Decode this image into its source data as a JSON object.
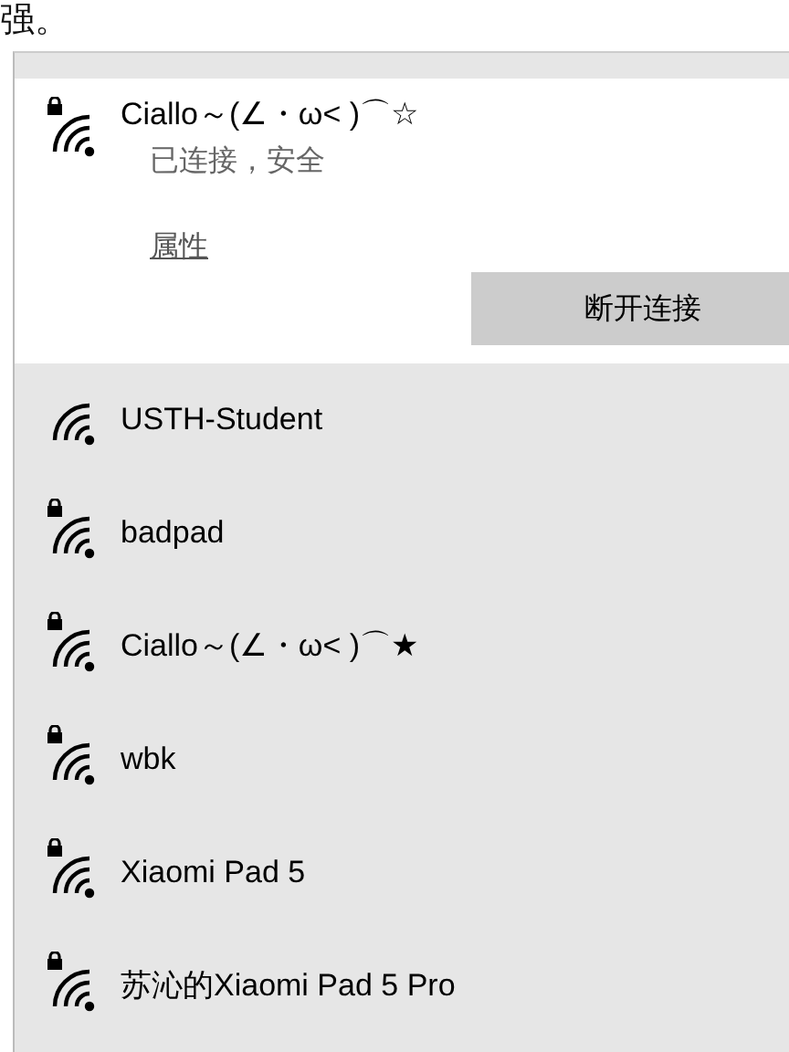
{
  "page": {
    "text": "强。"
  },
  "flyout": {
    "networks": [
      {
        "name": "Ciallo～(∠・ω< )⌒☆",
        "secured": true,
        "selected": true,
        "status": "已连接，安全",
        "properties_link": "属性",
        "action_button": "断开连接"
      },
      {
        "name": "USTH-Student",
        "secured": false,
        "selected": false
      },
      {
        "name": "badpad",
        "secured": true,
        "selected": false
      },
      {
        "name": "Ciallo～(∠・ω< )⌒★",
        "secured": true,
        "selected": false
      },
      {
        "name": "wbk",
        "secured": true,
        "selected": false
      },
      {
        "name": "Xiaomi Pad 5",
        "secured": true,
        "selected": false
      },
      {
        "name": "苏沁的Xiaomi Pad 5 Pro",
        "secured": true,
        "selected": false
      }
    ]
  }
}
